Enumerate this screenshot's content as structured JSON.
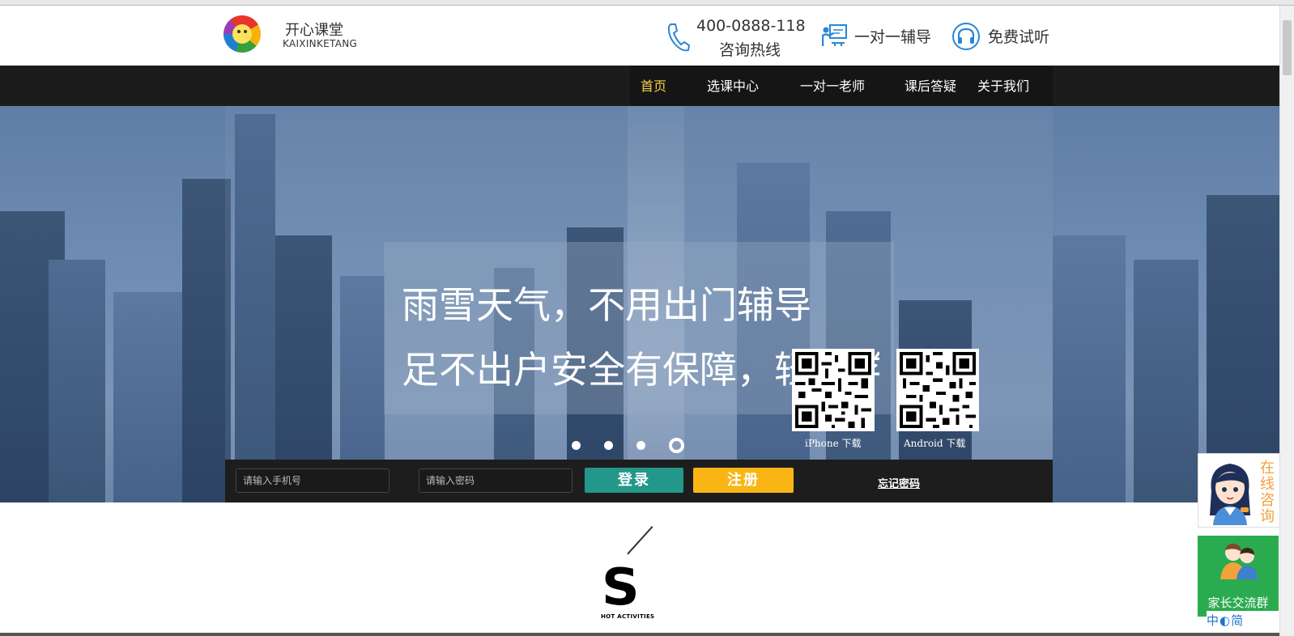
{
  "brand": {
    "name": "开心课堂",
    "sub": "KAIXINKETANG"
  },
  "header": {
    "hotline_number": "400-0888-118",
    "hotline_label": "咨询热线",
    "tutor_label": "一对一辅导",
    "trial_label": "免费试听"
  },
  "nav": {
    "items": [
      {
        "label": "首页",
        "active": true
      },
      {
        "label": "选课中心"
      },
      {
        "label": "一对一老师"
      },
      {
        "label": "课后答疑"
      },
      {
        "label": "关于我们"
      }
    ]
  },
  "hero": {
    "line1": "雨雪天气，不用出门辅导",
    "line2": "足不出户安全有保障，轻松学习",
    "dots": 4,
    "active_dot": 4
  },
  "qrcodes": {
    "iphone_label": "iPhone 下载",
    "android_label": "Android 下载"
  },
  "login": {
    "phone_placeholder": "请输入手机号",
    "password_placeholder": "请输入密码",
    "login_label": "登录",
    "register_label": "注册",
    "forgot_label": "忘记密码"
  },
  "section": {
    "letter": "S",
    "sub": "HOT ACTIVITIES"
  },
  "side": {
    "consult_label": "在线咨询",
    "group_label": "家长交流群",
    "lang_label": "中◐简"
  },
  "colors": {
    "nav_bg": "#1c1c1c",
    "nav_active": "#f5d24a",
    "login_btn": "#24978b",
    "register_btn": "#f8b514",
    "group_bg": "#2bab4f",
    "consult_text": "#f2a13a"
  }
}
